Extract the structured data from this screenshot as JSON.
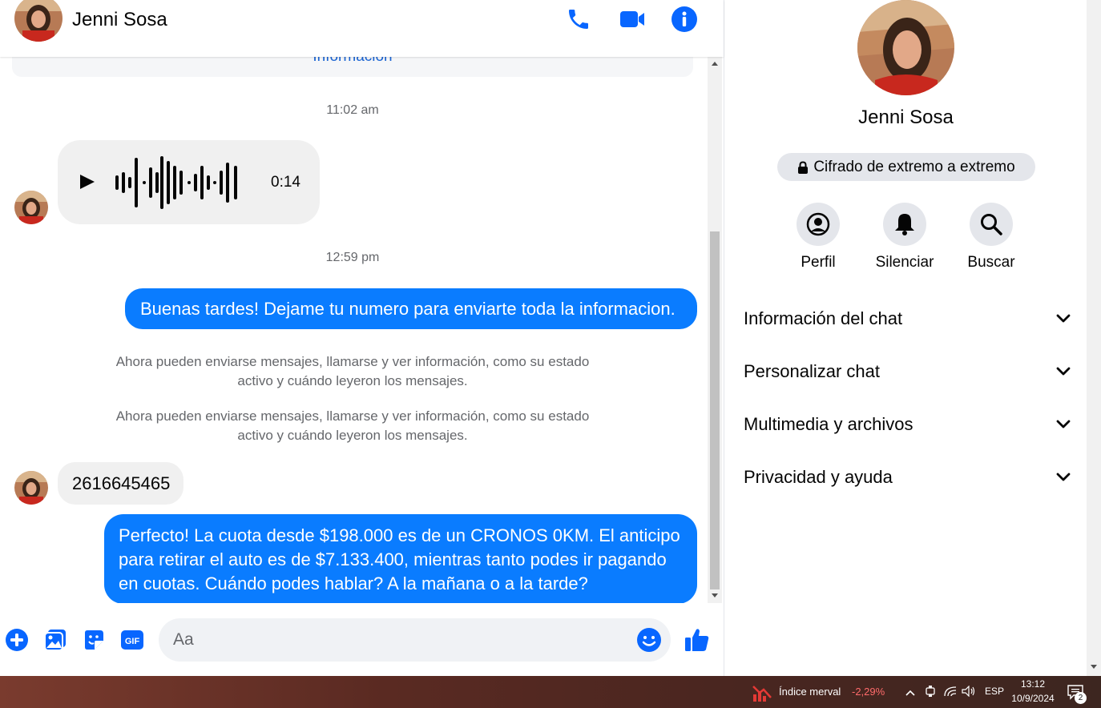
{
  "contact": {
    "name": "Jenni Sosa"
  },
  "header": {
    "call_icon": "phone-icon",
    "video_icon": "video-camera-icon",
    "info_icon": "info-icon"
  },
  "messages": {
    "info_link": "Información",
    "timestamp_1": "11:02 am",
    "voice_duration": "0:14",
    "timestamp_2": "12:59 pm",
    "out_1": "Buenas tardes! Dejame tu numero para enviarte toda la informacion.",
    "sys_1_line1": "Ahora pueden enviarse mensajes, llamarse y ver información, como su estado",
    "sys_1_line2": "activo y cuándo leyeron los mensajes.",
    "sys_2_line1": "Ahora pueden enviarse mensajes, llamarse y ver información, como su estado",
    "sys_2_line2": "activo y cuándo leyeron los mensajes.",
    "in_1": "2616645465",
    "out_2_line1": "Perfecto! La cuota desde $198.000 es de un CRONOS 0KM. El anticipo",
    "out_2_line2": "para retirar el auto es de $7.133.400, mientras tanto podes ir pagando",
    "out_2_line3": "en cuotas. Cuándo podes hablar? A la mañana o a la tarde?"
  },
  "composer": {
    "placeholder": "Aa",
    "value": ""
  },
  "panel": {
    "name": "Jenni Sosa",
    "encryption": "Cifrado de extremo a extremo",
    "actions": [
      {
        "label": "Perfil",
        "icon": "profile-icon"
      },
      {
        "label": "Silenciar",
        "icon": "bell-icon"
      },
      {
        "label": "Buscar",
        "icon": "search-icon"
      }
    ],
    "sections": [
      {
        "label": "Información del chat"
      },
      {
        "label": "Personalizar chat"
      },
      {
        "label": "Multimedia y archivos"
      },
      {
        "label": "Privacidad y ayuda"
      }
    ]
  },
  "taskbar": {
    "ticker_name": "Índice merval",
    "ticker_change": "-2,29%",
    "language": "ESP",
    "time": "13:12",
    "date": "10/9/2024",
    "notifications": "2"
  },
  "colors": {
    "accent": "#0a7cff",
    "icon_blue": "#0866ff",
    "ticker_negative": "#ff6b6b"
  }
}
